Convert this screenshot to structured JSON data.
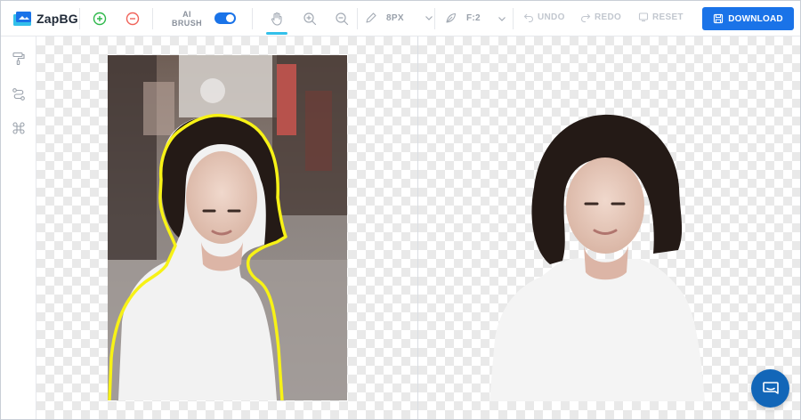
{
  "app": {
    "brand": "ZapBG"
  },
  "toolbar": {
    "ai_brush_label_line1": "AI",
    "ai_brush_label_line2": "BRUSH",
    "ai_brush_enabled": true,
    "brush_size_label": "8PX",
    "feather_label": "F:2",
    "undo_label": "UNDO",
    "redo_label": "REDO",
    "reset_label": "RESET",
    "download_label": "DOWNLOAD"
  },
  "icons": {
    "add": "plus-circle-icon",
    "remove": "minus-circle-icon",
    "hand": "hand-icon",
    "zoom_in": "zoom-in-icon",
    "zoom_out": "zoom-out-icon",
    "pencil": "pencil-icon",
    "feather": "feather-icon",
    "chevron": "chevron-down-icon",
    "undo": "undo-icon",
    "redo": "redo-icon",
    "reset": "reset-icon",
    "download": "save-icon",
    "rail": [
      "paint-roller-icon",
      "path-tool-icon",
      "command-icon"
    ],
    "chat": "chat-bubble-icon"
  },
  "colors": {
    "accent": "#1a73e8",
    "add_green": "#2eb84b",
    "remove_red": "#f0635a",
    "selection_outline": "#f7f216",
    "chat_button": "#1266b8"
  }
}
